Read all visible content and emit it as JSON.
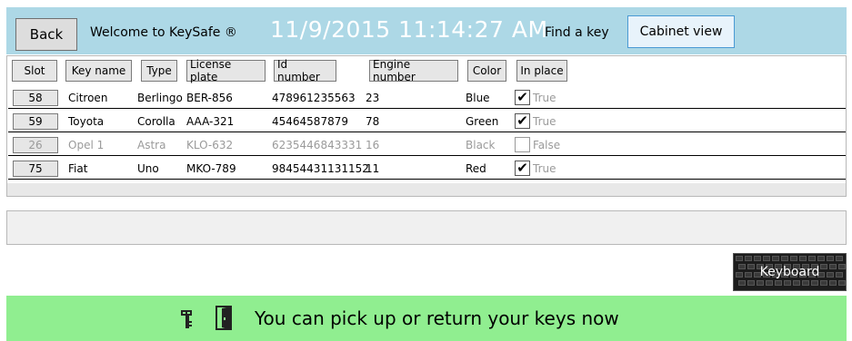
{
  "header": {
    "back_label": "Back",
    "welcome": "Welcome to KeySafe ®",
    "datetime": "11/9/2015  11:14:27 AM",
    "find_key": "Find a key",
    "cabinet_label": "Cabinet view",
    "background_color": "#add8e6"
  },
  "table": {
    "columns": [
      {
        "key": "slot",
        "label": "Slot"
      },
      {
        "key": "key_name",
        "label": "Key name"
      },
      {
        "key": "type",
        "label": "Type"
      },
      {
        "key": "plate",
        "label": "License plate"
      },
      {
        "key": "id_number",
        "label": "Id number"
      },
      {
        "key": "engine",
        "label": "Engine number"
      },
      {
        "key": "color",
        "label": "Color"
      },
      {
        "key": "in_place",
        "label": "In place"
      }
    ],
    "rows": [
      {
        "slot": "58",
        "key_name": "Citroen",
        "type": "Berlingo",
        "plate": "BER-856",
        "id_number": "478961235563",
        "engine": "23",
        "color": "Blue",
        "in_place": "True",
        "checked": true,
        "enabled": true
      },
      {
        "slot": "59",
        "key_name": "Toyota",
        "type": "Corolla",
        "plate": "AAA-321",
        "id_number": "45464587879",
        "engine": "78",
        "color": "Green",
        "in_place": "True",
        "checked": true,
        "enabled": true
      },
      {
        "slot": "26",
        "key_name": "Opel 1",
        "type": "Astra",
        "plate": "KLO-632",
        "id_number": "6235446843331",
        "engine": "16",
        "color": "Black",
        "in_place": "False",
        "checked": false,
        "enabled": false
      },
      {
        "slot": "75",
        "key_name": "Fiat",
        "type": "Uno",
        "plate": "MKO-789",
        "id_number": "98454431131152",
        "engine": "11",
        "color": "Red",
        "in_place": "True",
        "checked": true,
        "enabled": true
      }
    ]
  },
  "keyboard": {
    "label": "Keyboard"
  },
  "status": {
    "message": "You can pick up or return your keys now",
    "background_color": "#90ee90",
    "icons": [
      "key-icon",
      "door-icon"
    ]
  }
}
